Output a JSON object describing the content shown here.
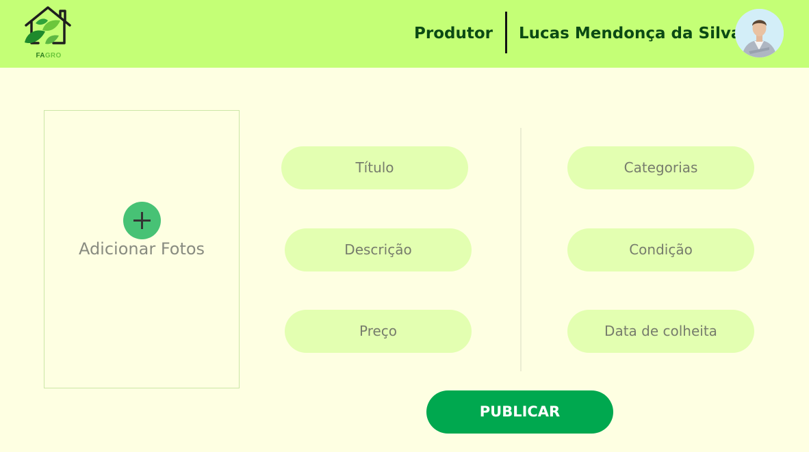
{
  "header": {
    "logo": {
      "icon": "house-with-leaves-icon",
      "text_part1": "FA",
      "text_part2": "GRO"
    },
    "role": "Produtor",
    "user_name": "Lucas Mendonça da Silva",
    "avatar_icon": "user-avatar"
  },
  "photos": {
    "add_icon": "plus-icon",
    "label": "Adicionar Fotos"
  },
  "form": {
    "titulo": "Título",
    "descricao": "Descrição",
    "preco": "Preço",
    "categorias": "Categorias",
    "condicao": "Condição",
    "data_colheita": "Data de colheita"
  },
  "publish_button": "PUBLICAR",
  "colors": {
    "page_bg": "#FEFFE2",
    "header_bg": "#C4FF76",
    "field_bg": "#E3FFB1",
    "publish_bg": "#00A84F",
    "add_button": "#47C275",
    "text_dark_green": "#0B4A14"
  }
}
